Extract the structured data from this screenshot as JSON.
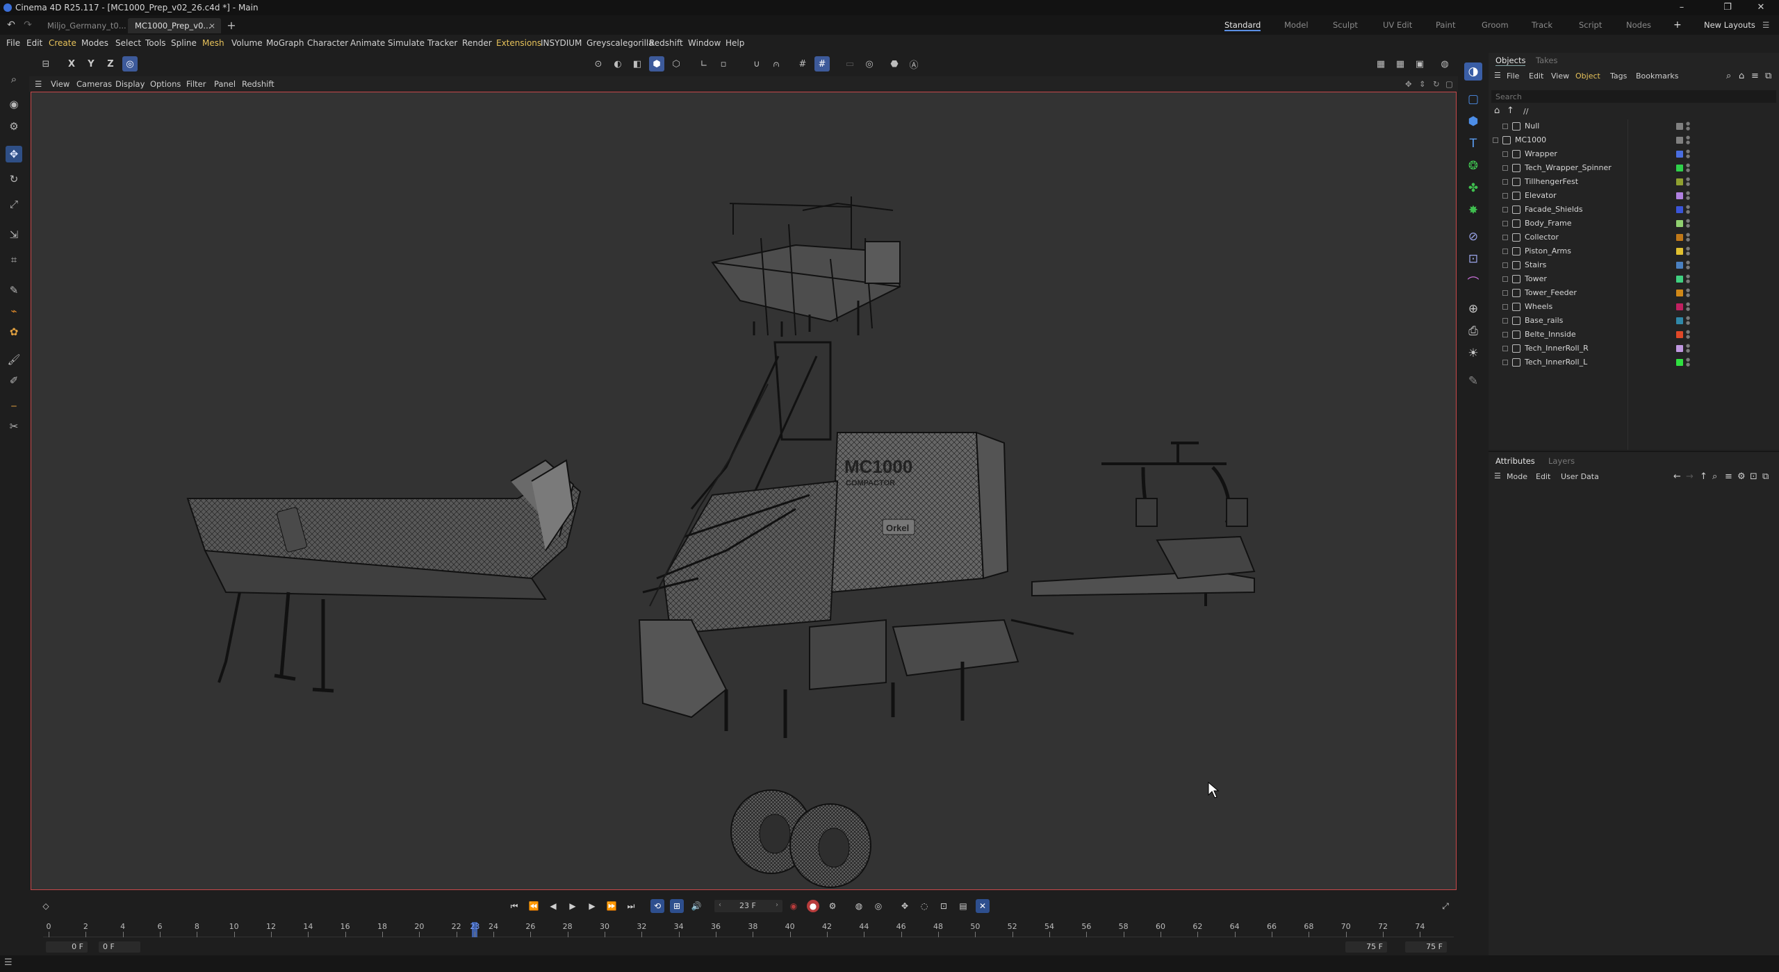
{
  "window": {
    "title": "Cinema 4D R25.117 - [MC1000_Prep_v02_26.c4d *] - Main"
  },
  "tabs": [
    {
      "label": "Miljo_Germany_t0..."
    },
    {
      "label": "MC1000_Prep_v0..."
    }
  ],
  "layouts": [
    "Standard",
    "Model",
    "Sculpt",
    "UV Edit",
    "Paint",
    "Groom",
    "Track",
    "Script",
    "Nodes"
  ],
  "new_layouts_label": "New Layouts",
  "menu": [
    "File",
    "Edit",
    "Create",
    "Modes",
    "Select",
    "Tools",
    "Spline",
    "Mesh",
    "Volume",
    "MoGraph",
    "Character",
    "Animate",
    "Simulate",
    "Tracker",
    "Render",
    "Extensions",
    "INSYDIUM",
    "Greyscalegorilla",
    "Redshift",
    "Window",
    "Help"
  ],
  "axes": [
    "X",
    "Y",
    "Z"
  ],
  "viewport_menu": [
    "View",
    "Cameras",
    "Display",
    "Options",
    "Filter",
    "Panel",
    "Redshift"
  ],
  "objects_panel": {
    "tabs": [
      "Objects",
      "Takes"
    ],
    "menu": [
      "File",
      "Edit",
      "View",
      "Object",
      "Tags",
      "Bookmarks"
    ],
    "search_placeholder": "Search",
    "path": "//",
    "items": [
      {
        "name": "Null",
        "color": "#808080",
        "indent": 1
      },
      {
        "name": "MC1000",
        "color": "#808080",
        "indent": 0
      },
      {
        "name": "Wrapper",
        "color": "#4a6ee0",
        "indent": 1
      },
      {
        "name": "Tech_Wrapper_Spinner",
        "color": "#2fd04a",
        "indent": 1
      },
      {
        "name": "TillhengerFest",
        "color": "#8fa030",
        "indent": 1
      },
      {
        "name": "Elevator",
        "color": "#b080e0",
        "indent": 1
      },
      {
        "name": "Facade_Shields",
        "color": "#3a55d8",
        "indent": 1
      },
      {
        "name": "Body_Frame",
        "color": "#90d070",
        "indent": 1
      },
      {
        "name": "Collector",
        "color": "#c07818",
        "indent": 1
      },
      {
        "name": "Piston_Arms",
        "color": "#e0c030",
        "indent": 1
      },
      {
        "name": "Stairs",
        "color": "#4a80c0",
        "indent": 1
      },
      {
        "name": "Tower",
        "color": "#40d080",
        "indent": 1
      },
      {
        "name": "Tower_Feeder",
        "color": "#d08818",
        "indent": 1
      },
      {
        "name": "Wheels",
        "color": "#c02060",
        "indent": 1
      },
      {
        "name": "Base_rails",
        "color": "#3088a8",
        "indent": 1
      },
      {
        "name": "Belte_Innside",
        "color": "#e04828",
        "indent": 1
      },
      {
        "name": "Tech_InnerRoll_R",
        "color": "#c098e0",
        "indent": 1
      },
      {
        "name": "Tech_InnerRoll_L",
        "color": "#30e040",
        "indent": 1
      }
    ]
  },
  "attributes_panel": {
    "tabs": [
      "Attributes",
      "Layers"
    ],
    "menu": [
      "Mode",
      "Edit",
      "User Data"
    ]
  },
  "timeline": {
    "current_frame": "23 F",
    "start_field": "0 F",
    "start_field2": "0 F",
    "end_field": "75 F",
    "end_field2": "75 F",
    "ruler_labels": [
      "0",
      "2",
      "4",
      "6",
      "8",
      "10",
      "12",
      "14",
      "16",
      "18",
      "20",
      "22",
      "23",
      "24",
      "26",
      "28",
      "30",
      "32",
      "34",
      "36",
      "38",
      "40",
      "42",
      "44",
      "46",
      "48",
      "50",
      "52",
      "54",
      "56",
      "58",
      "60",
      "62",
      "64",
      "66",
      "68",
      "70",
      "72",
      "74"
    ],
    "ruler_current": 23,
    "ruler_max": 75
  },
  "viewport": {
    "model_text": "MC1000",
    "model_subtext": "COMPACTOR",
    "brand": "Orkel"
  }
}
